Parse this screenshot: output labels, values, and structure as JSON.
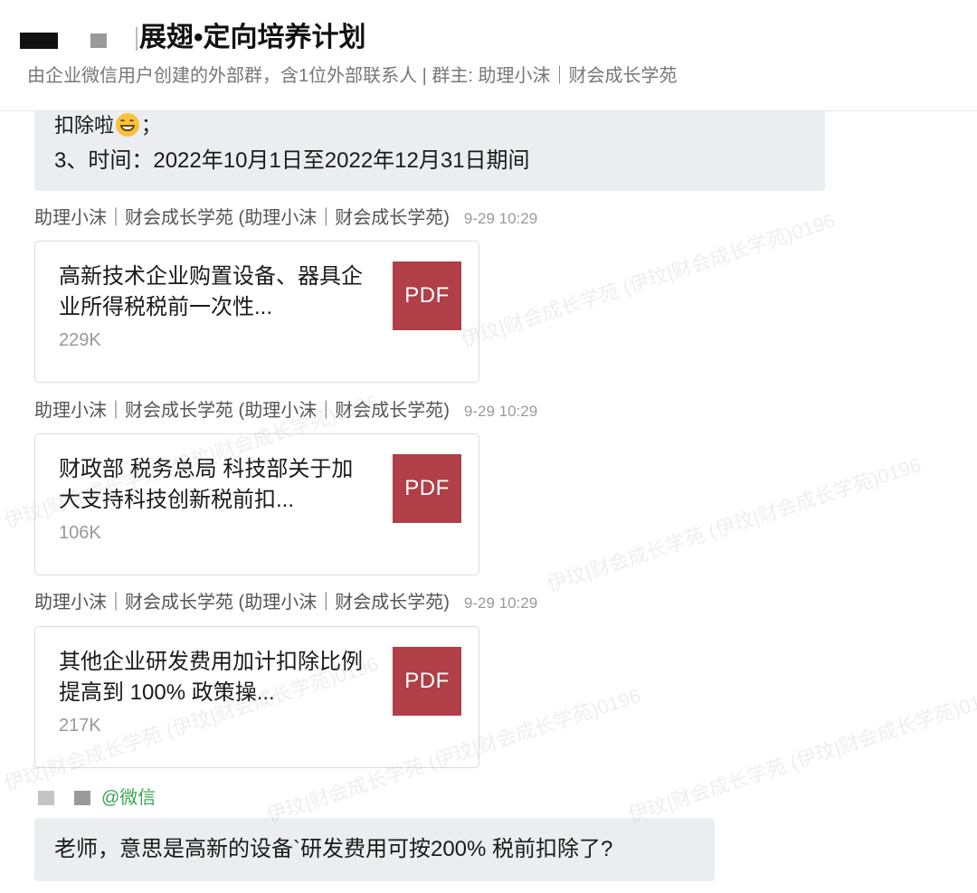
{
  "header": {
    "title": "展翅•定向培养计划",
    "subtitle": "由企业微信用户创建的外部群，含1位外部联系人 | 群主: 助理小沫｜财会成长学苑"
  },
  "previous_message": {
    "line1_prefix": "扣除啦",
    "line1_emoji": "grinning-face-emoji",
    "line1_suffix": "；",
    "line2": "3、时间：2022年10月1日至2022年12月31日期间"
  },
  "messages": [
    {
      "sender": "助理小沫｜财会成长学苑 (助理小沫｜财会成长学苑)",
      "time": "9-29 10:29",
      "file_name": "高新技术企业购置设备、器具企业所得税税前一次性...",
      "file_size": "229K",
      "file_type": "PDF"
    },
    {
      "sender": "助理小沫｜财会成长学苑 (助理小沫｜财会成长学苑)",
      "time": "9-29 10:29",
      "file_name": "财政部 税务总局 科技部关于加大支持科技创新税前扣...",
      "file_size": "106K",
      "file_type": "PDF"
    },
    {
      "sender": "助理小沫｜财会成长学苑 (助理小沫｜财会成长学苑)",
      "time": "9-29 10:29",
      "file_name": "其他企业研发费用加计扣除比例提高到 100% 政策操...",
      "file_size": "217K",
      "file_type": "PDF"
    }
  ],
  "reply": {
    "sender_tag": "@微信",
    "text": "老师，意思是高新的设备`研发费用可按200% 税前扣除了?"
  },
  "watermark_text": "伊玟|财会成长学苑 (伊玟|财会成长学苑)0196",
  "colors": {
    "pdf_icon": "#b03f47",
    "bubble_bg": "#ebedf0",
    "wechat_tag": "#3aa655"
  }
}
